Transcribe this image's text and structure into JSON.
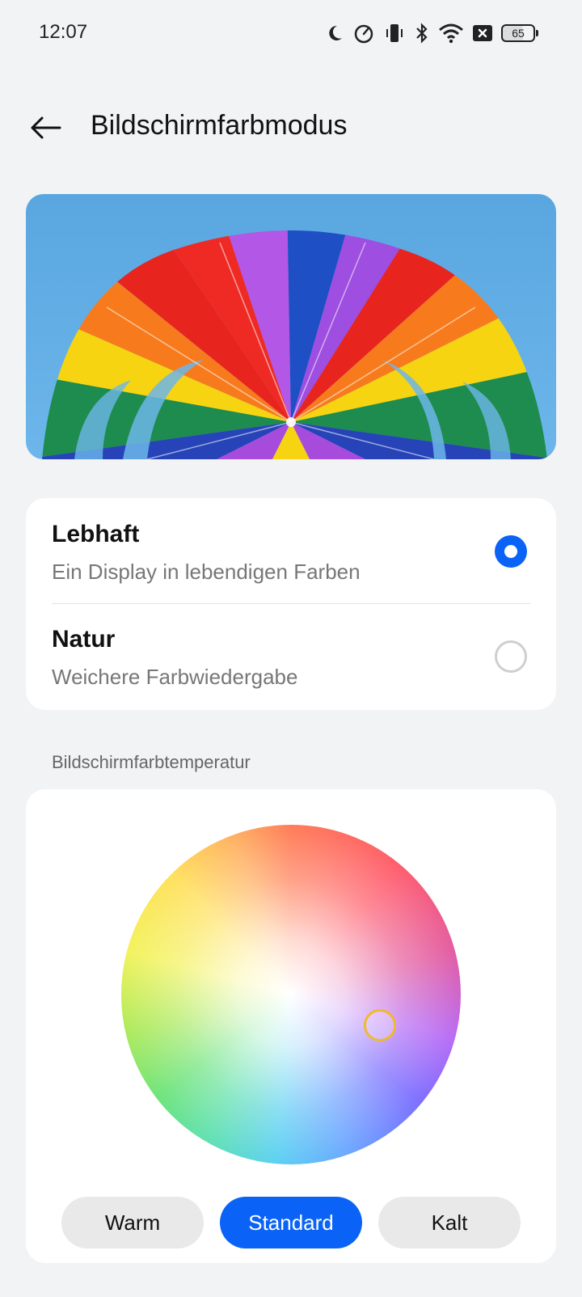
{
  "status_bar": {
    "time": "12:07",
    "battery": "65",
    "icons": [
      "moon-icon",
      "speedometer-icon",
      "vibrate-icon",
      "bluetooth-icon",
      "wifi-icon",
      "x-box-icon",
      "battery-icon"
    ]
  },
  "header": {
    "title": "Bildschirmfarbmodus",
    "back_icon": "arrow-left-icon"
  },
  "preview": {
    "image": "rainbow-parachute"
  },
  "modes": [
    {
      "title": "Lebhaft",
      "subtitle": "Ein Display in lebendigen Farben",
      "selected": true
    },
    {
      "title": "Natur",
      "subtitle": "Weichere Farbwiedergabe",
      "selected": false
    }
  ],
  "temperature": {
    "section_label": "Bildschirmfarbtemperatur",
    "buttons": [
      "Warm",
      "Standard",
      "Kalt"
    ],
    "active_button": "Standard"
  },
  "colors": {
    "accent": "#0a63f6",
    "background": "#f2f3f5",
    "card": "#ffffff",
    "handle": "#f0b92e"
  }
}
